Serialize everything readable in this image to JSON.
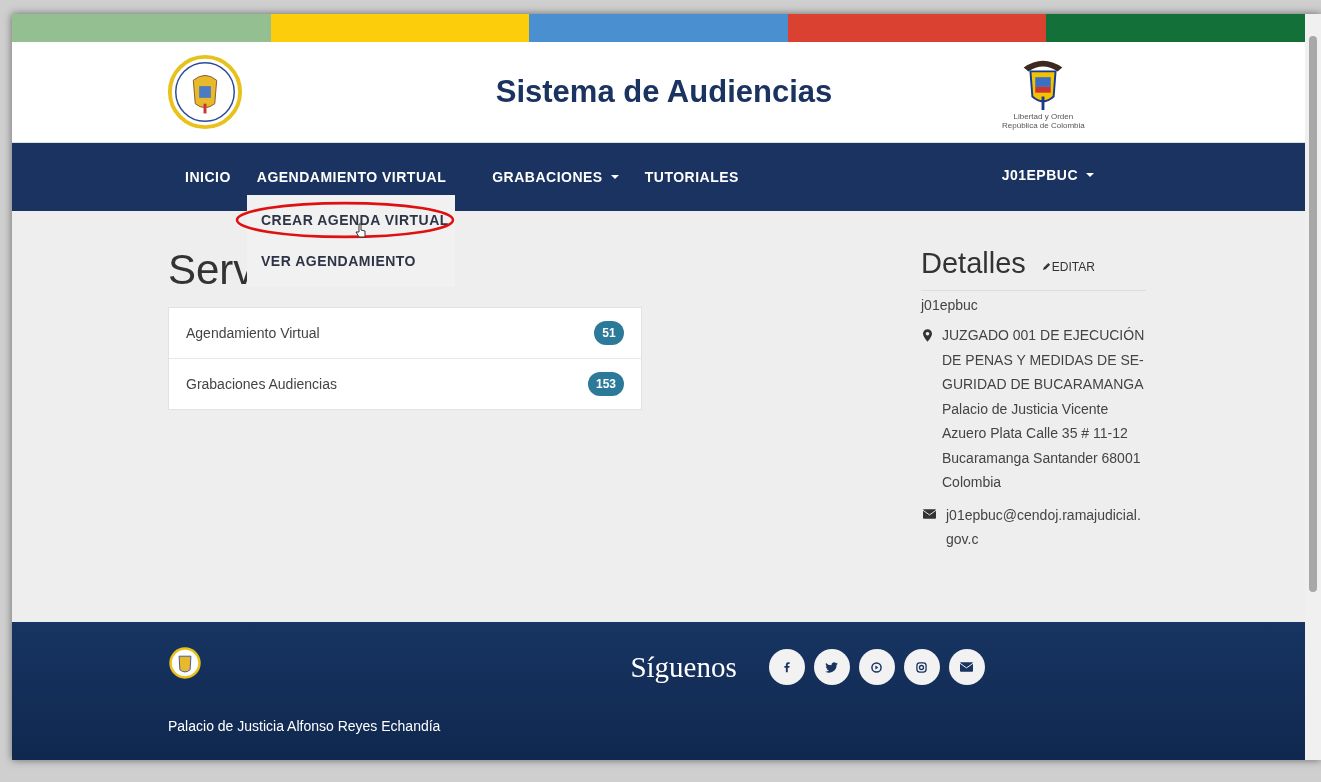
{
  "header": {
    "title": "Sistema de Audiencias",
    "crest_caption": [
      "Libertad y Orden",
      "República de Colombia"
    ]
  },
  "nav": {
    "items": [
      {
        "label": "INICIO",
        "dropdown": false
      },
      {
        "label": "AGENDAMIENTO VIRTUAL",
        "dropdown": false
      },
      {
        "label": "GRABACIONES",
        "dropdown": true
      },
      {
        "label": "TUTORIALES",
        "dropdown": false
      }
    ],
    "user": {
      "label": "J01EPBUC",
      "dropdown": true
    }
  },
  "dropdown_menu": {
    "items": [
      {
        "label": "CREAR AGENDA VIRTUAL",
        "highlighted": true
      },
      {
        "label": "VER AGENDAMIENTO",
        "highlighted": false
      }
    ]
  },
  "services": {
    "title": "Serv",
    "items": [
      {
        "label": "Agendamiento Virtual",
        "count": "51"
      },
      {
        "label": "Grabaciones Audiencias",
        "count": "153"
      }
    ]
  },
  "details": {
    "title": "Detalles",
    "edit_label": "EDITAR",
    "username": "j01epbuc",
    "address": "JUZGADO 001 DE EJECUCIÓN DE PENAS Y MEDIDAS DE SE-GURIDAD DE BUCARAMANGA Palacio de Justicia Vicente Azuero Plata Calle 35 # 11-12 Bucaramanga Santander 68001 Colombia",
    "email": "j01epbuc@cendoj.ramajudicial.gov.c"
  },
  "footer": {
    "follow_label": "Síguenos",
    "social": [
      {
        "kind": "facebook"
      },
      {
        "kind": "twitter"
      },
      {
        "kind": "play"
      },
      {
        "kind": "instagram"
      },
      {
        "kind": "mail"
      }
    ],
    "address": "Palacio de Justicia Alfonso Reyes Echandía"
  }
}
